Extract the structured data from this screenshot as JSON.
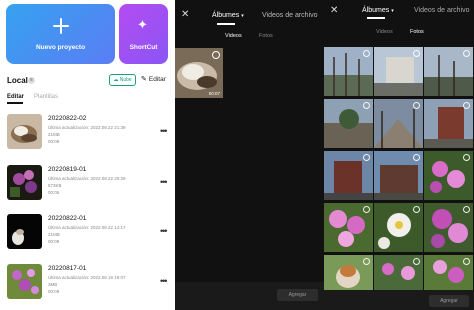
{
  "home": {
    "new_project_label": "Nuevo proyecto",
    "shortcut_label": "ShortCut",
    "local_label": "Local",
    "local_info": "≡",
    "cloud_label": "Nube",
    "edit_label": "Editar",
    "tab_edit": "Editar",
    "tab_templates": "Plantillas",
    "projects": [
      {
        "name": "20220822-02",
        "updated": "Última actualización: 2022.08.22 21:39",
        "size": "21MB",
        "duration": "00:09"
      },
      {
        "name": "20220819-01",
        "updated": "Última actualización: 2022.08.22 20:28",
        "size": "573KB",
        "duration": "00:05"
      },
      {
        "name": "20220822-01",
        "updated": "Última actualización: 2022.08.22 14:17",
        "size": "21MB",
        "duration": "00:09"
      },
      {
        "name": "20220817-01",
        "updated": "Última actualización: 2022.08.19 19:07",
        "size": "3MB",
        "duration": "00:09"
      }
    ]
  },
  "videos_panel": {
    "albums_label": "Álbumes",
    "files_label": "Videos de archivo",
    "tab_videos": "Videos",
    "tab_photos": "Fotos",
    "video_duration": "00:07",
    "add_label": "Agregar"
  },
  "photos_panel": {
    "albums_label": "Álbumes",
    "files_label": "Videos de archivo",
    "tab_videos": "Videos",
    "tab_photos": "Fotos",
    "add_label": "Agregar"
  },
  "icons": {
    "close": "close-icon",
    "plus": "plus-icon",
    "wand": "magic-wand-icon",
    "more": "more-icon",
    "pen": "edit-pen-icon",
    "cloud": "cloud-icon",
    "chevron": "chevron-down-icon"
  },
  "colors": {
    "new_project_bg": "#35a2ef",
    "shortcut_bg": "#b44cf0",
    "cloud_accent": "#1aa37a",
    "dark_bg": "#111111"
  }
}
